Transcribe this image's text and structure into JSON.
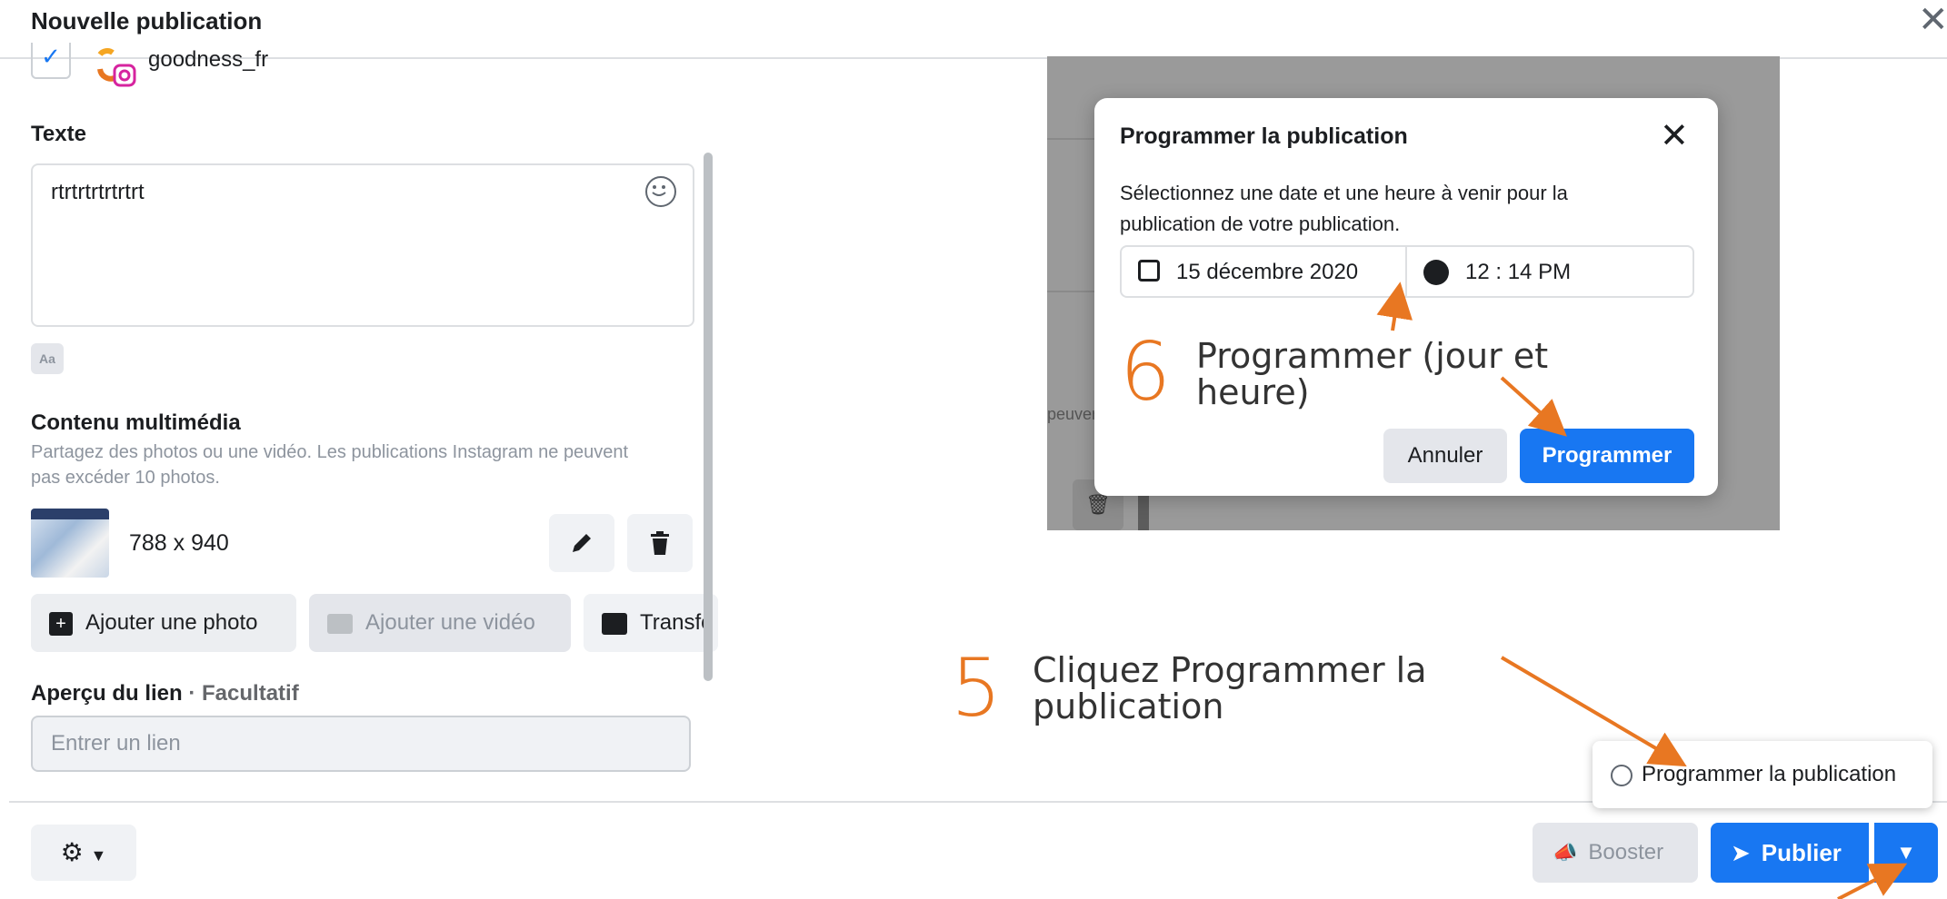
{
  "window": {
    "title": "Nouvelle publication"
  },
  "account": {
    "name": "goodness_fr"
  },
  "text_section": {
    "label": "Texte",
    "value": "rtrtrtrtrtrtrt"
  },
  "media": {
    "label": "Contenu multimédia",
    "description_line1": "Partagez des photos ou une vidéo. Les publications Instagram ne peuvent",
    "description_line2": "pas excéder 10 photos.",
    "dimensions": "788 x 940",
    "add_photo": "Ajouter une photo",
    "add_video": "Ajouter une vidéo",
    "transform": "Transfo"
  },
  "link_preview": {
    "label": "Aperçu du lien",
    "optional": "· Facultatif",
    "placeholder": "Entrer un lien"
  },
  "footer": {
    "booster": "Booster",
    "publish": "Publier",
    "schedule_option": "Programmer la publication"
  },
  "preview": {
    "partial_text": "peuver"
  },
  "dialog": {
    "title": "Programmer la publication",
    "description_line1": "Sélectionnez une date et une heure à venir pour la",
    "description_line2": "publication de votre publication.",
    "date": "15 décembre 2020",
    "time": "12 : 14 PM",
    "cancel": "Annuler",
    "confirm": "Programmer"
  },
  "annotations": {
    "step5_num": "5",
    "step5_line1": "Cliquez Programmer la",
    "step5_line2": "publication",
    "step6_num": "6",
    "step6_line1": "Programmer (jour et",
    "step6_line2": "heure)",
    "arrow_color": "#e87722"
  }
}
